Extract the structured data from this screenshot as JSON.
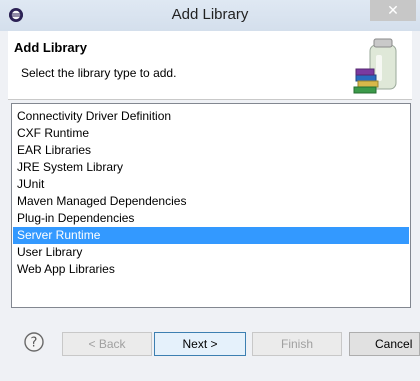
{
  "window": {
    "title": "Add Library",
    "close_glyph": "✕"
  },
  "header": {
    "title": "Add Library",
    "description": "Select the library type to add."
  },
  "list": {
    "items": [
      {
        "label": "Connectivity Driver Definition",
        "selected": false
      },
      {
        "label": "CXF Runtime",
        "selected": false
      },
      {
        "label": "EAR Libraries",
        "selected": false
      },
      {
        "label": "JRE System Library",
        "selected": false
      },
      {
        "label": "JUnit",
        "selected": false
      },
      {
        "label": "Maven Managed Dependencies",
        "selected": false
      },
      {
        "label": "Plug-in Dependencies",
        "selected": false
      },
      {
        "label": "Server Runtime",
        "selected": true
      },
      {
        "label": "User Library",
        "selected": false
      },
      {
        "label": "Web App Libraries",
        "selected": false
      }
    ]
  },
  "buttons": {
    "back": "< Back",
    "next": "Next >",
    "finish": "Finish",
    "cancel": "Cancel"
  },
  "icons": {
    "app": "eclipse-icon",
    "help": "help-icon",
    "banner": "library-jar-books-icon"
  },
  "colors": {
    "selection": "#3399ff",
    "titlebar": "#d9e4f1"
  }
}
